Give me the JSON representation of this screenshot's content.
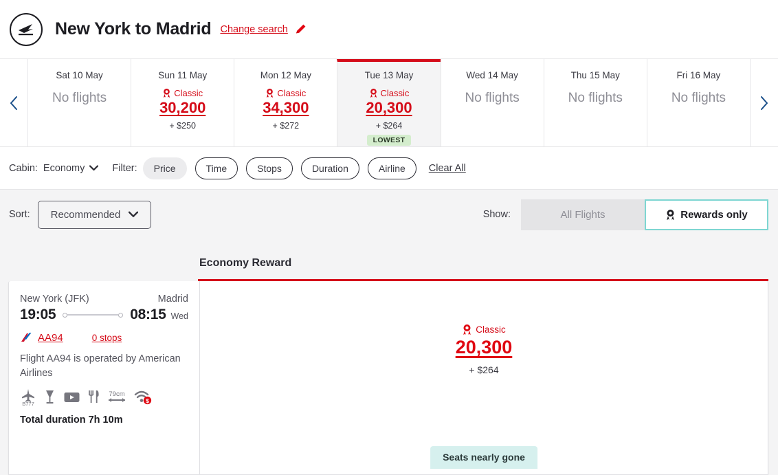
{
  "header": {
    "logo_icon": "airplane-logo-icon",
    "title": "New York to Madrid",
    "change_search_label": "Change search",
    "pencil_icon": "pencil-icon"
  },
  "date_strip": {
    "prev_icon": "chevron-left-icon",
    "next_icon": "chevron-right-icon",
    "no_flights_label": "No flights",
    "classic_label": "Classic",
    "lowest_label": "LOWEST",
    "days": [
      {
        "label": "Sat 10 May",
        "has_flights": false,
        "points": "",
        "cash": "",
        "lowest": false,
        "selected": false
      },
      {
        "label": "Sun 11 May",
        "has_flights": true,
        "points": "30,200",
        "cash": "+ $250",
        "lowest": false,
        "selected": false
      },
      {
        "label": "Mon 12 May",
        "has_flights": true,
        "points": "34,300",
        "cash": "+ $272",
        "lowest": false,
        "selected": false
      },
      {
        "label": "Tue 13 May",
        "has_flights": true,
        "points": "20,300",
        "cash": "+ $264",
        "lowest": true,
        "selected": true
      },
      {
        "label": "Wed 14 May",
        "has_flights": false,
        "points": "",
        "cash": "",
        "lowest": false,
        "selected": false
      },
      {
        "label": "Thu 15 May",
        "has_flights": false,
        "points": "",
        "cash": "",
        "lowest": false,
        "selected": false
      },
      {
        "label": "Fri 16 May",
        "has_flights": false,
        "points": "",
        "cash": "",
        "lowest": false,
        "selected": false
      }
    ]
  },
  "filter_bar": {
    "cabin_label": "Cabin:",
    "cabin_value": "Economy",
    "cabin_chevron_icon": "chevron-down-icon",
    "filter_label": "Filter:",
    "pills": [
      {
        "label": "Price",
        "active": true
      },
      {
        "label": "Time",
        "active": false
      },
      {
        "label": "Stops",
        "active": false
      },
      {
        "label": "Duration",
        "active": false
      },
      {
        "label": "Airline",
        "active": false
      }
    ],
    "clear_all_label": "Clear All"
  },
  "sort_show": {
    "sort_label": "Sort:",
    "sort_value": "Recommended",
    "sort_chevron_icon": "chevron-down-icon",
    "show_label": "Show:",
    "toggle": {
      "all_flights_label": "All Flights",
      "rewards_only_label": "Rewards only",
      "rewards_icon": "award-ribbon-icon",
      "selected": "rewards_only"
    }
  },
  "results": {
    "tabs": [
      {
        "label": "Economy Reward",
        "active": true
      }
    ],
    "flight": {
      "origin": "New York (JFK)",
      "destination": "Madrid",
      "depart_time": "19:05",
      "arrive_time": "08:15",
      "arrive_day": "Wed",
      "airline_logo_icon": "american-airlines-logo-icon",
      "flight_number": "AA94",
      "stops": "0 stops",
      "operated_by": "Flight AA94 is operated by American Airlines",
      "amenities": [
        {
          "icon": "aircraft-type-icon",
          "label": "B777"
        },
        {
          "icon": "drink-icon",
          "label": ""
        },
        {
          "icon": "entertainment-screen-icon",
          "label": ""
        },
        {
          "icon": "meal-icon",
          "label": ""
        },
        {
          "icon": "seat-pitch-icon",
          "label": "79cm"
        },
        {
          "icon": "paid-wifi-icon",
          "label": ""
        }
      ],
      "total_duration": "Total duration 7h 10m",
      "price": {
        "tier_icon": "award-ribbon-icon",
        "tier_label": "Classic",
        "points": "20,300",
        "cash": "+ $264"
      },
      "seats_badge": "Seats nearly gone"
    }
  },
  "colors": {
    "brand_red": "#d50c19",
    "price_red": "#e00711",
    "lowest_green": "#d4edcd",
    "teal_accent": "#7ed6d2",
    "seats_badge_bg": "#d6f0ee",
    "page_bg": "#f4f4f5"
  }
}
